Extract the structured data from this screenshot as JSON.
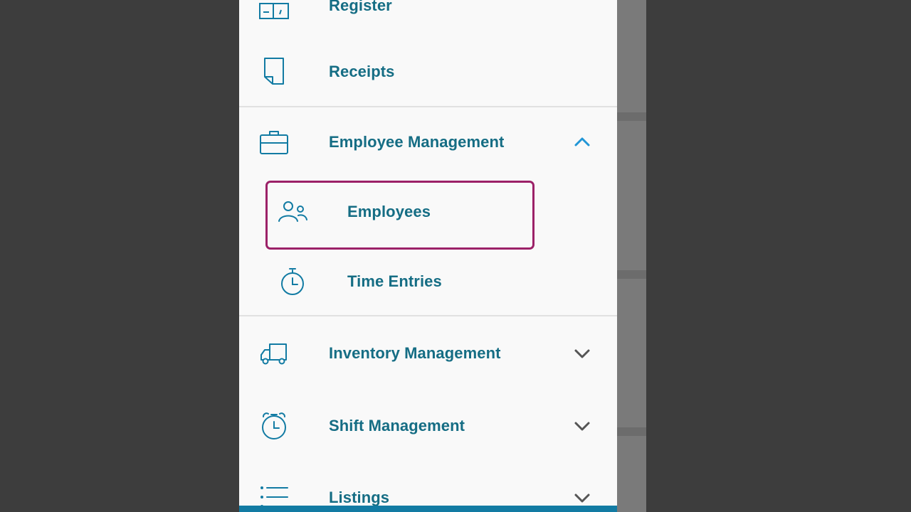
{
  "colors": {
    "label": "#156d84",
    "icon": "#127ba3",
    "chevron_expanded": "#2196d6",
    "chevron_collapsed": "#555555",
    "selected_outline": "#9c2168",
    "drawer_bg": "#f9f9f9"
  },
  "nav": {
    "register": {
      "label": "Register",
      "icon": "register-icon"
    },
    "receipts": {
      "label": "Receipts",
      "icon": "receipt-icon"
    },
    "employee_management": {
      "label": "Employee Management",
      "icon": "briefcase-icon",
      "expanded": true,
      "children": {
        "employees": {
          "label": "Employees",
          "icon": "people-icon",
          "selected": true
        },
        "time_entries": {
          "label": "Time Entries",
          "icon": "stopwatch-icon"
        }
      }
    },
    "inventory_management": {
      "label": "Inventory Management",
      "icon": "truck-icon",
      "expanded": false
    },
    "shift_management": {
      "label": "Shift Management",
      "icon": "alarm-clock-icon",
      "expanded": false
    },
    "listings": {
      "label": "Listings",
      "icon": "list-icon",
      "expanded": false
    }
  }
}
